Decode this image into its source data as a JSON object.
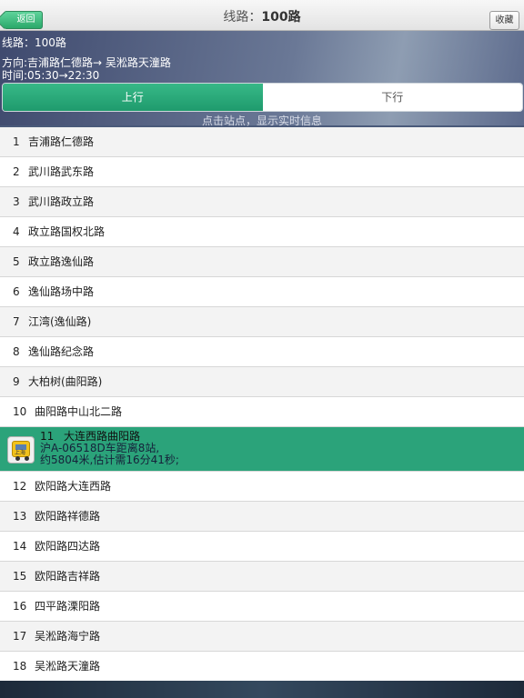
{
  "nav": {
    "back_label": "返回",
    "title_prefix": "线路：",
    "title_route": "100路",
    "favorite_label": "收藏"
  },
  "info": {
    "route_line": "线路：100路",
    "direction_line": "方向:吉浦路仁德路→ 吴淞路天潼路",
    "time_line": "时间:05:30→22:30"
  },
  "direction_toggle": {
    "up_label": "上行",
    "down_label": "下行",
    "selected": "上行"
  },
  "hint": "点击站点，显示实时信息",
  "stops": [
    {
      "num": "1",
      "name": "吉浦路仁德路"
    },
    {
      "num": "2",
      "name": "武川路武东路"
    },
    {
      "num": "3",
      "name": "武川路政立路"
    },
    {
      "num": "4",
      "name": "政立路国权北路"
    },
    {
      "num": "5",
      "name": "政立路逸仙路"
    },
    {
      "num": "6",
      "name": "逸仙路场中路"
    },
    {
      "num": "7",
      "name": "江湾(逸仙路)"
    },
    {
      "num": "8",
      "name": "逸仙路纪念路"
    },
    {
      "num": "9",
      "name": "大柏树(曲阳路)"
    },
    {
      "num": "10",
      "name": "曲阳路中山北二路"
    },
    {
      "num": "11",
      "name": "大连西路曲阳路"
    },
    {
      "num": "12",
      "name": "欧阳路大连西路"
    },
    {
      "num": "13",
      "name": "欧阳路祥德路"
    },
    {
      "num": "14",
      "name": "欧阳路四达路"
    },
    {
      "num": "15",
      "name": "欧阳路吉祥路"
    },
    {
      "num": "16",
      "name": "四平路溧阳路"
    },
    {
      "num": "17",
      "name": "吴淞路海宁路"
    },
    {
      "num": "18",
      "name": "吴淞路天潼路"
    }
  ],
  "active_stop": {
    "num": "11",
    "name": "大连西路曲阳路",
    "bus_info": "沪A-06518D车距离8站,",
    "eta_info": "约5804米,估计需16分41秒;",
    "icon_text": "上海",
    "highlight_color": "#2ba37a"
  }
}
